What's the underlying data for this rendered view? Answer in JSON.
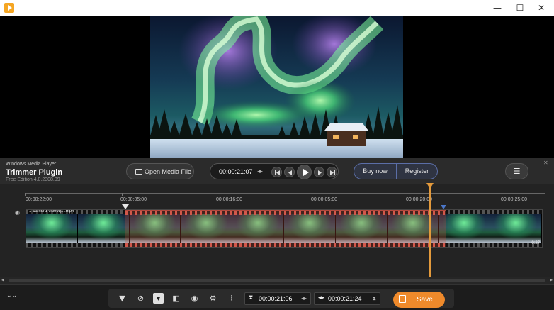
{
  "window": {
    "controls": {
      "minimize": "—",
      "maximize": "☐",
      "close": "✕"
    }
  },
  "panel": {
    "app_name": "Windows Media Player",
    "plugin_title": "Trimmer Plugin",
    "edition": "Free Edition 4.0.2308.09",
    "open_button": "Open Media File",
    "current_time": "00:00:21:07",
    "buy_button": "Buy now",
    "register_button": "Register",
    "menu_icon": "☰"
  },
  "timeline": {
    "ruler_labels": [
      "00:00:22:00",
      "00:00:05:00",
      "00:00:16:00",
      "00:00:05:00",
      "00:00:20:00",
      "00:00:25:00"
    ],
    "clip_name": "1-camera-videoq....mp4",
    "clip_duration": "0:27"
  },
  "toolbar": {
    "start_time": "00:00:21:06",
    "end_time": "00:00:21:24",
    "save_button": "Save"
  },
  "colors": {
    "accent_orange": "#ef8a2b",
    "playhead": "#e39a3c",
    "selection": "#b2483d",
    "buy_border": "#5b6ea7"
  }
}
